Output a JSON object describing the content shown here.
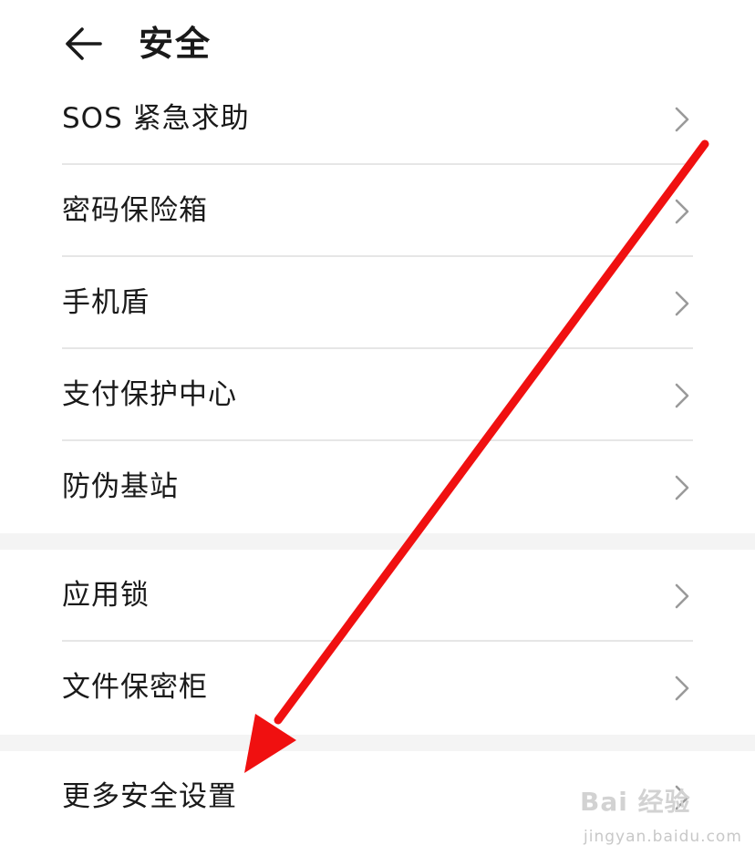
{
  "header": {
    "title": "安全"
  },
  "groups": [
    {
      "items": [
        {
          "label": "SOS 紧急求助"
        },
        {
          "label": "密码保险箱"
        },
        {
          "label": "手机盾"
        },
        {
          "label": "支付保护中心"
        },
        {
          "label": "防伪基站"
        }
      ]
    },
    {
      "items": [
        {
          "label": "应用锁"
        },
        {
          "label": "文件保密柜"
        }
      ]
    },
    {
      "items": [
        {
          "label": "更多安全设置"
        }
      ]
    }
  ],
  "annotation": {
    "arrow_color": "#f01010"
  },
  "watermark": {
    "logo": "Bai 经验",
    "url": "jingyan.baidu.com"
  },
  "colors": {
    "divider": "#e6e6e6",
    "gap": "#f4f4f4",
    "chevron": "#9a9a9a",
    "text": "#1a1a1a"
  },
  "icons": {
    "back": "arrow-left-icon",
    "row": "chevron-right-icon"
  }
}
